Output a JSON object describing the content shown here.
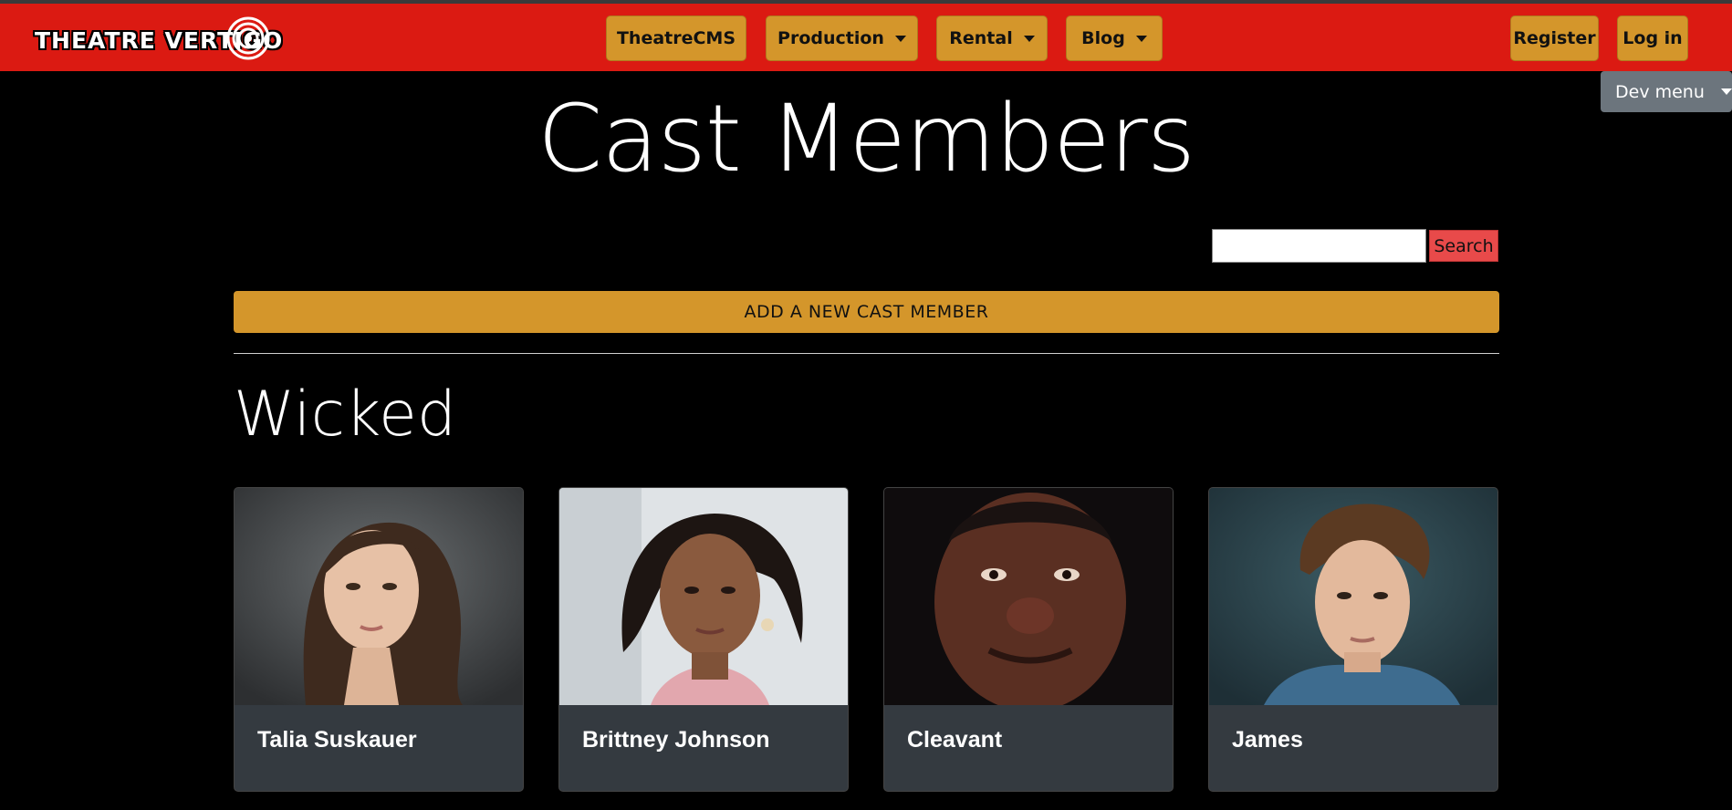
{
  "brand": {
    "name": "THEATRE VERTIGO"
  },
  "navbar": {
    "items": [
      {
        "label": "TheatreCMS",
        "dropdown": false
      },
      {
        "label": "Production",
        "dropdown": true
      },
      {
        "label": "Rental",
        "dropdown": true
      },
      {
        "label": "Blog",
        "dropdown": true
      }
    ],
    "register_label": "Register",
    "login_label": "Log in",
    "dev_menu_label": "Dev menu"
  },
  "page": {
    "title": "Cast Members",
    "search_value": "",
    "search_button": "Search",
    "add_button": "ADD A NEW CAST MEMBER"
  },
  "production": {
    "name": "Wicked",
    "cast": [
      {
        "name": "Talia Suskauer"
      },
      {
        "name": "Brittney Johnson"
      },
      {
        "name": "Cleavant"
      },
      {
        "name": "James"
      }
    ]
  },
  "colors": {
    "navbar": "#db1a12",
    "button_gold": "#d4962b",
    "search_red": "#e84a4a",
    "card": "#343a40",
    "dev_menu": "#6c757d"
  }
}
